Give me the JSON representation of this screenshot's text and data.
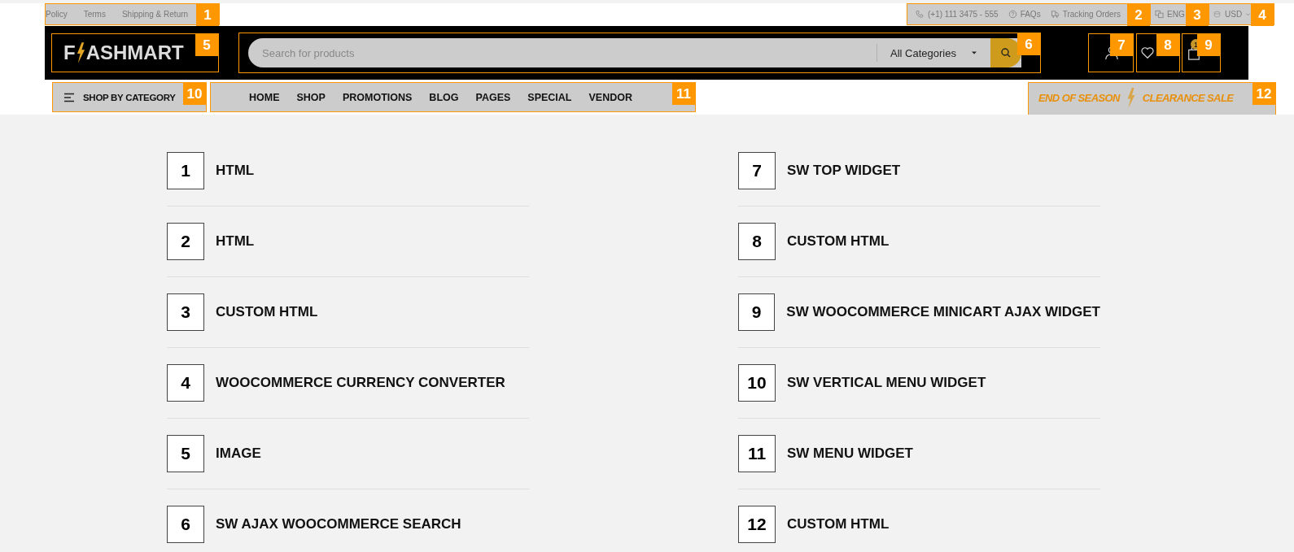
{
  "top_bar": {
    "links": [
      "Policy",
      "Terms",
      "Shipping & Return"
    ],
    "links_callout": "1",
    "contacts": [
      {
        "kind": "phone",
        "label": "(+1) 111 3475 - 555"
      },
      {
        "kind": "faq",
        "label": "FAQs"
      },
      {
        "kind": "tracking",
        "label": "Tracking Orders"
      }
    ],
    "contacts_callout": "2",
    "language": {
      "label": "ENG",
      "callout": "3"
    },
    "currency": {
      "label": "USD",
      "callout": "4"
    }
  },
  "header": {
    "logo": {
      "before": "F",
      "after": "ASHMART",
      "callout": "5"
    },
    "search": {
      "placeholder": "Search for products",
      "category": "All Categories",
      "callout": "6"
    },
    "account": {
      "callout": "7"
    },
    "wishlist": {
      "callout": "8"
    },
    "cart": {
      "count": "1",
      "callout": "9"
    }
  },
  "nav": {
    "category_button": {
      "label": "SHOP BY CATEGORY",
      "callout": "10"
    },
    "menu": {
      "items": [
        "HOME",
        "SHOP",
        "PROMOTIONS",
        "BLOG",
        "PAGES",
        "SPECIAL",
        "VENDOR"
      ],
      "callout": "11"
    },
    "promo": {
      "before": "END OF SEASON",
      "after": "CLEARANCE SALE",
      "callout": "12"
    }
  },
  "legend": [
    {
      "number": "1",
      "label": "HTML"
    },
    {
      "number": "2",
      "label": "HTML"
    },
    {
      "number": "3",
      "label": "CUSTOM HTML"
    },
    {
      "number": "4",
      "label": "WOOCOMMERCE CURRENCY CONVERTER"
    },
    {
      "number": "5",
      "label": "IMAGE"
    },
    {
      "number": "6",
      "label": "SW AJAX WOOCOMMERCE SEARCH"
    },
    {
      "number": "7",
      "label": "SW TOP WIDGET"
    },
    {
      "number": "8",
      "label": "CUSTOM HTML"
    },
    {
      "number": "9",
      "label": "SW WOOCOMMERCE MINICART AJAX WIDGET"
    },
    {
      "number": "10",
      "label": "SW VERTICAL MENU WIDGET"
    },
    {
      "number": "11",
      "label": "SW MENU WIDGET"
    },
    {
      "number": "12",
      "label": "CUSTOM HTML"
    }
  ]
}
